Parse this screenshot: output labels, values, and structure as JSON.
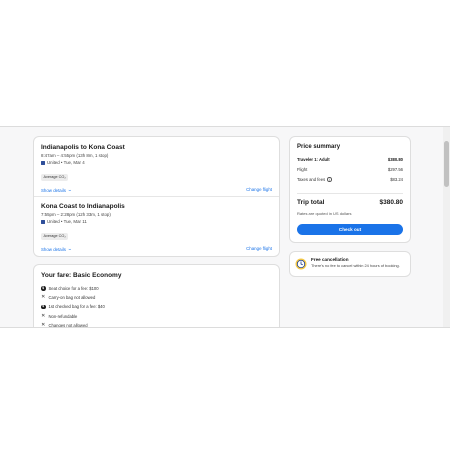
{
  "itinerary": {
    "segments": [
      {
        "title": "Indianapolis to Kona Coast",
        "times": "8:47am – 4:55pm (13h 8m, 1 stop)",
        "airline": "United • Tue, Mar 4",
        "badge": "Average CO₂",
        "show_details": "Show details",
        "change_flight": "Change flight"
      },
      {
        "title": "Kona Coast to Indianapolis",
        "times": "7:55pm – 2:28pm (12h 33m, 1 stop)",
        "airline": "United • Tue, Mar 11",
        "badge": "Average CO₂",
        "show_details": "Show details",
        "change_flight": "Change flight"
      }
    ]
  },
  "fare": {
    "title": "Your fare: Basic Economy",
    "items": [
      {
        "icon": "dollar-icon",
        "text": "Seat choice for a fee: $100"
      },
      {
        "icon": "x-icon",
        "text": "Carry-on bag not allowed"
      },
      {
        "icon": "dollar-icon",
        "text": "1st checked bag for a fee: $40"
      },
      {
        "icon": "x-icon",
        "text": "Non-refundable"
      },
      {
        "icon": "x-icon",
        "text": "Changes not allowed"
      }
    ]
  },
  "price_summary": {
    "title": "Price summary",
    "traveler_label": "Traveler 1: Adult",
    "traveler_amount": "$380.80",
    "flight_label": "Flight",
    "flight_amount": "$297.56",
    "taxes_label": "Taxes and fees",
    "taxes_amount": "$83.24",
    "total_label": "Trip total",
    "total_amount": "$380.80",
    "rates_note": "Rates are quoted in US dollars",
    "checkout_label": "Check out"
  },
  "cancellation": {
    "title": "Free cancellation",
    "description": "There's no fee to cancel within 24 hours of booking."
  },
  "colors": {
    "accent": "#1a73e8",
    "clock_yellow": "#f6c945"
  }
}
